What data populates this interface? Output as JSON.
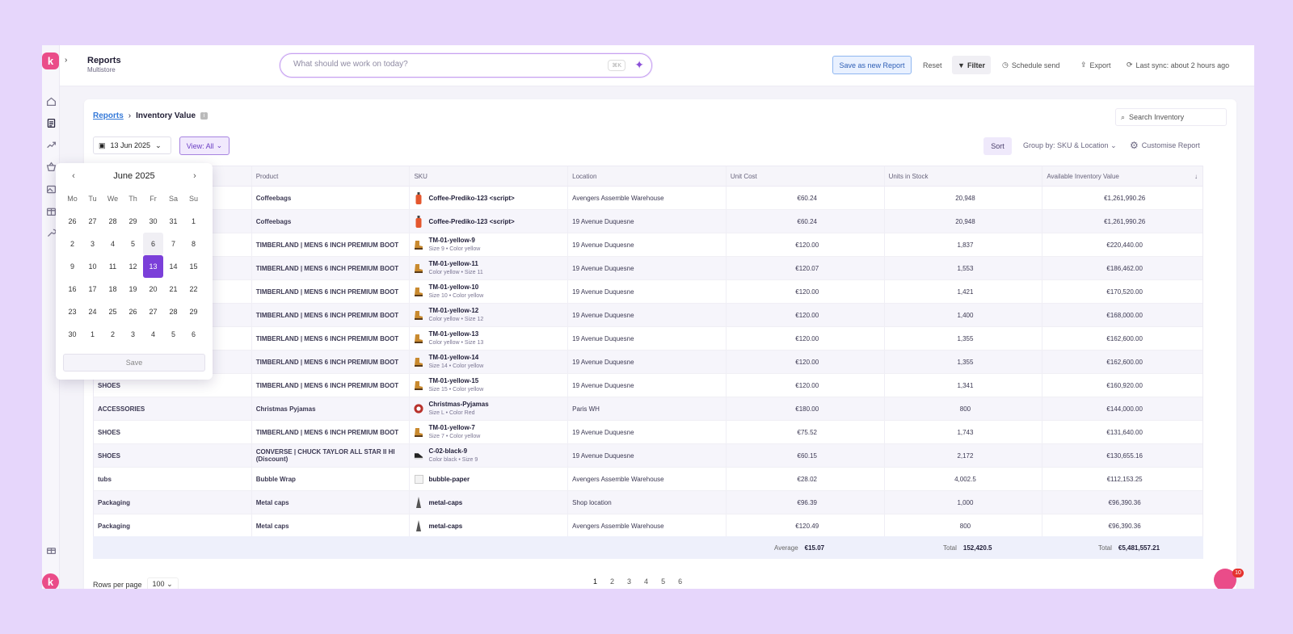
{
  "header": {
    "title": "Reports",
    "subtitle": "Multistore",
    "prompt_placeholder": "What should we work on today?",
    "kbd_hint": "⌘K",
    "save_new": "Save as new Report",
    "reset": "Reset",
    "filter": "Filter",
    "schedule": "Schedule send",
    "export": "Export",
    "sync": "Last sync: about 2 hours ago"
  },
  "breadcrumb": {
    "root": "Reports",
    "current": "Inventory Value"
  },
  "search_placeholder": "Search Inventory",
  "toolbar": {
    "date": "13 Jun 2025",
    "view": "View: All",
    "sort": "Sort",
    "group_by": "Group by: SKU & Location",
    "customise": "Customise Report"
  },
  "table": {
    "columns": [
      "Product",
      "SKU",
      "Location",
      "Unit Cost",
      "Units in Stock",
      "Available Inventory Value"
    ],
    "rows": [
      {
        "cat": "",
        "product": "Coffeebags",
        "sku": "Coffee-Prediko-123 <script>",
        "variant": "",
        "thumb": "bottle",
        "location": "Avengers Assemble Warehouse",
        "cost": "€60.24",
        "units": "20,948",
        "value": "€1,261,990.26"
      },
      {
        "cat": "",
        "product": "Coffeebags",
        "sku": "Coffee-Prediko-123 <script>",
        "variant": "",
        "thumb": "bottle",
        "location": "19 Avenue Duquesne",
        "cost": "€60.24",
        "units": "20,948",
        "value": "€1,261,990.26"
      },
      {
        "cat": "",
        "product": "TIMBERLAND | MENS 6 INCH PREMIUM BOOT",
        "sku": "TM-01-yellow-9",
        "variant": "Size 9 • Color yellow",
        "thumb": "boot",
        "location": "19 Avenue Duquesne",
        "cost": "€120.00",
        "units": "1,837",
        "value": "€220,440.00"
      },
      {
        "cat": "",
        "product": "TIMBERLAND | MENS 6 INCH PREMIUM BOOT",
        "sku": "TM-01-yellow-11",
        "variant": "Color yellow • Size 11",
        "thumb": "boot",
        "location": "19 Avenue Duquesne",
        "cost": "€120.07",
        "units": "1,553",
        "value": "€186,462.00"
      },
      {
        "cat": "",
        "product": "TIMBERLAND | MENS 6 INCH PREMIUM BOOT",
        "sku": "TM-01-yellow-10",
        "variant": "Size 10 • Color yellow",
        "thumb": "boot",
        "location": "19 Avenue Duquesne",
        "cost": "€120.00",
        "units": "1,421",
        "value": "€170,520.00"
      },
      {
        "cat": "",
        "product": "TIMBERLAND | MENS 6 INCH PREMIUM BOOT",
        "sku": "TM-01-yellow-12",
        "variant": "Color yellow • Size 12",
        "thumb": "boot",
        "location": "19 Avenue Duquesne",
        "cost": "€120.00",
        "units": "1,400",
        "value": "€168,000.00"
      },
      {
        "cat": "",
        "product": "TIMBERLAND | MENS 6 INCH PREMIUM BOOT",
        "sku": "TM-01-yellow-13",
        "variant": "Color yellow • Size 13",
        "thumb": "boot",
        "location": "19 Avenue Duquesne",
        "cost": "€120.00",
        "units": "1,355",
        "value": "€162,600.00"
      },
      {
        "cat": "",
        "product": "TIMBERLAND | MENS 6 INCH PREMIUM BOOT",
        "sku": "TM-01-yellow-14",
        "variant": "Size 14 • Color yellow",
        "thumb": "boot",
        "location": "19 Avenue Duquesne",
        "cost": "€120.00",
        "units": "1,355",
        "value": "€162,600.00"
      },
      {
        "cat": "SHOES",
        "product": "TIMBERLAND | MENS 6 INCH PREMIUM BOOT",
        "sku": "TM-01-yellow-15",
        "variant": "Size 15 • Color yellow",
        "thumb": "boot",
        "location": "19 Avenue Duquesne",
        "cost": "€120.00",
        "units": "1,341",
        "value": "€160,920.00"
      },
      {
        "cat": "ACCESSORIES",
        "product": "Christmas Pyjamas",
        "sku": "Christmas-Pyjamas",
        "variant": "Size L • Color Red",
        "thumb": "pyjama",
        "location": "Paris WH",
        "cost": "€180.00",
        "units": "800",
        "value": "€144,000.00"
      },
      {
        "cat": "SHOES",
        "product": "TIMBERLAND | MENS 6 INCH PREMIUM BOOT",
        "sku": "TM-01-yellow-7",
        "variant": "Size 7 • Color yellow",
        "thumb": "boot",
        "location": "19 Avenue Duquesne",
        "cost": "€75.52",
        "units": "1,743",
        "value": "€131,640.00"
      },
      {
        "cat": "SHOES",
        "product": "CONVERSE | CHUCK TAYLOR ALL STAR II HI (Discount)",
        "sku": "C-02-black-9",
        "variant": "Color black • Size 9",
        "thumb": "sneaker",
        "location": "19 Avenue Duquesne",
        "cost": "€60.15",
        "units": "2,172",
        "value": "€130,655.16"
      },
      {
        "cat": "tubs",
        "product": "Bubble Wrap",
        "sku": "bubble-paper",
        "variant": "",
        "thumb": "wrap",
        "location": "Avengers Assemble Warehouse",
        "cost": "€28.02",
        "units": "4,002.5",
        "value": "€112,153.25"
      },
      {
        "cat": "Packaging",
        "product": "Metal caps",
        "sku": "metal-caps",
        "variant": "",
        "thumb": "cap",
        "location": "Shop location",
        "cost": "€96.39",
        "units": "1,000",
        "value": "€96,390.36"
      },
      {
        "cat": "Packaging",
        "product": "Metal caps",
        "sku": "metal-caps",
        "variant": "",
        "thumb": "cap",
        "location": "Avengers Assemble Warehouse",
        "cost": "€120.49",
        "units": "800",
        "value": "€96,390.36"
      }
    ],
    "totals": {
      "avg_label": "Average",
      "avg_value": "€15.07",
      "units_label": "Total",
      "units_value": "152,420.5",
      "value_label": "Total",
      "value_value": "€5,481,557.21"
    }
  },
  "pagination": {
    "rows_label": "Rows per page",
    "rows_value": "100",
    "pages": [
      "1",
      "2",
      "3",
      "4",
      "5",
      "6"
    ],
    "current": "1"
  },
  "chat_badge": "10",
  "calendar": {
    "month": "June 2025",
    "weekdays": [
      "Mo",
      "Tu",
      "We",
      "Th",
      "Fr",
      "Sa",
      "Su"
    ],
    "days": [
      "26",
      "27",
      "28",
      "29",
      "30",
      "31",
      "1",
      "2",
      "3",
      "4",
      "5",
      "6",
      "7",
      "8",
      "9",
      "10",
      "11",
      "12",
      "13",
      "14",
      "15",
      "16",
      "17",
      "18",
      "19",
      "20",
      "21",
      "22",
      "23",
      "24",
      "25",
      "26",
      "27",
      "28",
      "29",
      "30",
      "1",
      "2",
      "3",
      "4",
      "5",
      "6"
    ],
    "today_index": 11,
    "selected_index": 18,
    "save": "Save"
  },
  "colors": {
    "accent": "#7b3fd9",
    "brand": "#ea4c89",
    "link": "#3579d8",
    "background": "#e6d6fb"
  }
}
